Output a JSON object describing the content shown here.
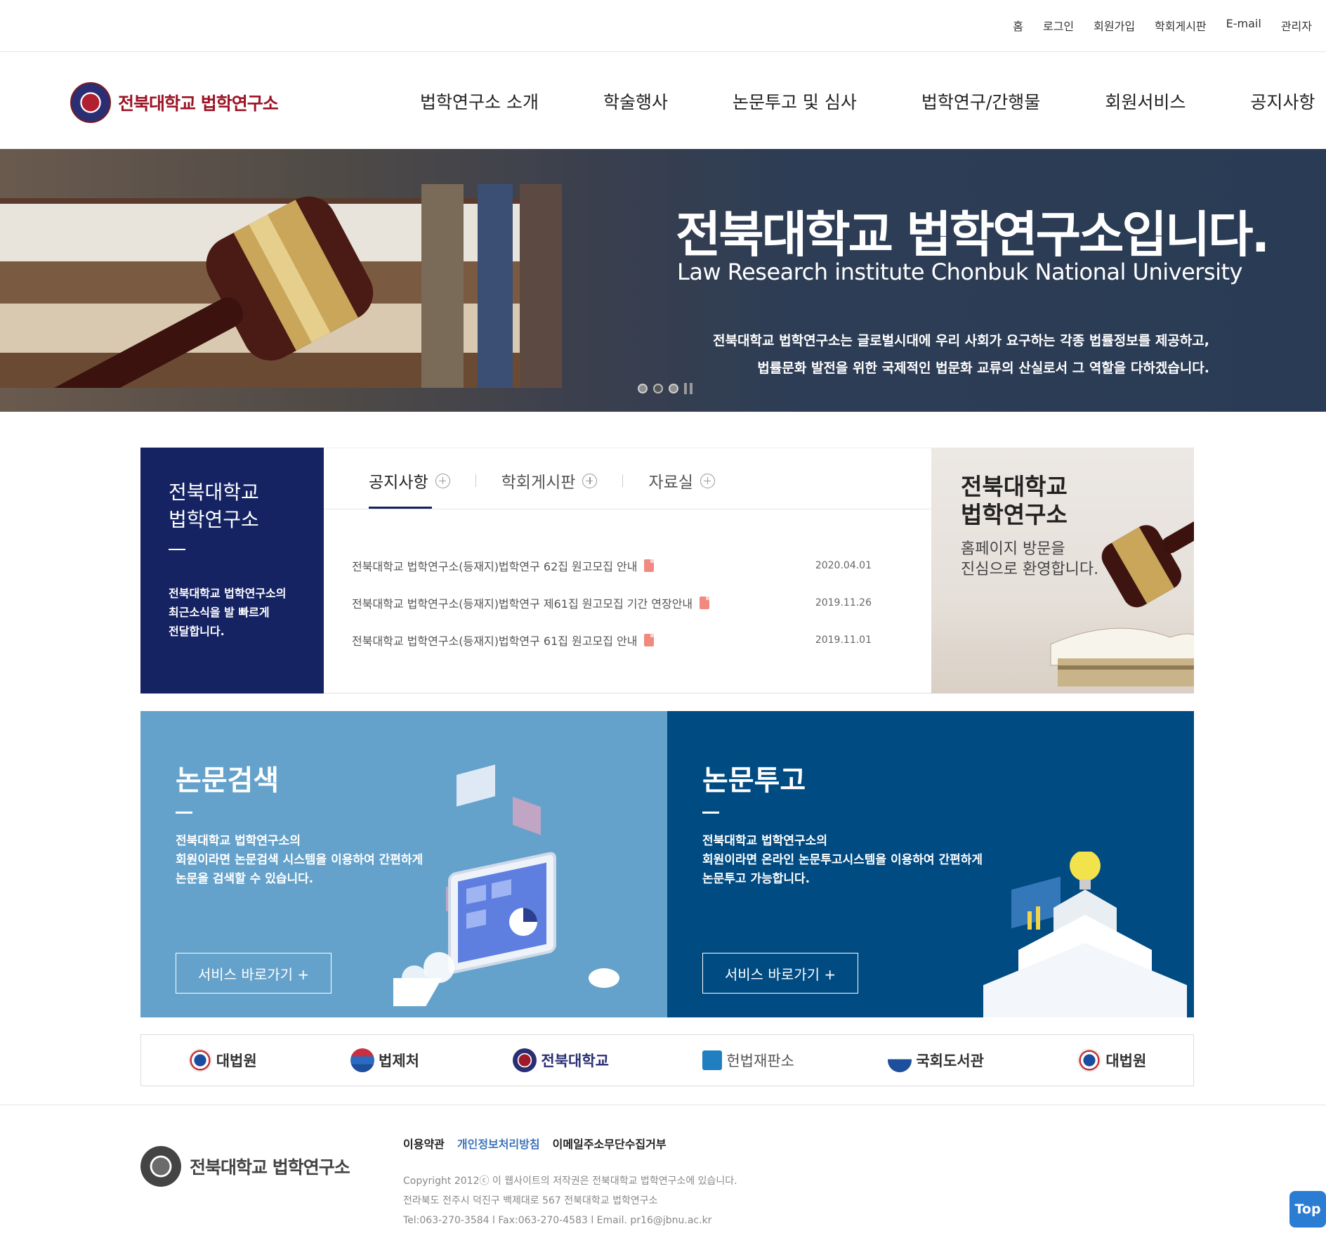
{
  "util_menu": [
    "홈",
    "로그인",
    "회원가입",
    "학회게시판",
    "E-mail",
    "관리자"
  ],
  "logo_text": "전북대학교 법학연구소",
  "gnb": [
    "법학연구소 소개",
    "학술행사",
    "논문투고 및 심사",
    "법학연구/간행물",
    "회원서비스",
    "공지사항"
  ],
  "hero": {
    "title": "전북대학교 법학연구소입니다.",
    "subtitle": "Law Research institute Chonbuk National University",
    "desc1": "전북대학교 법학연구소는 글로벌시대에 우리 사회가 요구하는 각종 법률정보를 제공하고,",
    "desc2": "법률문화 발전을 위한 국제적인 법문화 교류의 산실로서 그 역할을 다하겠습니다."
  },
  "notice_box": {
    "title1": "전북대학교",
    "title2": "법학연구소",
    "desc1": "전북대학교 법학연구소의",
    "desc2": "최근소식을 발 빠르게",
    "desc3": "전달합니다."
  },
  "tabs": [
    "공지사항",
    "학회게시판",
    "자료실"
  ],
  "notices": [
    {
      "title": "전북대학교 법학연구소(등재지)법학연구 62집 원고모집 안내",
      "date": "2020.04.01"
    },
    {
      "title": "전북대학교 법학연구소(등재지)법학연구 제61집 원고모집 기간 연장안내",
      "date": "2019.11.26"
    },
    {
      "title": "전북대학교 법학연구소(등재지)법학연구 61집 원고모집 안내",
      "date": "2019.11.01"
    }
  ],
  "welcome": {
    "title1": "전북대학교",
    "title2": "법학연구소",
    "line1": "홈페이지 방문을",
    "line2": "진심으로 환영합니다."
  },
  "search_service": {
    "title": "논문검색",
    "line1": "전북대학교 법학연구소의",
    "line2": "회원이라면 논문검색 시스템을 이용하여 간편하게",
    "line3": "논문을 검색할 수 있습니다.",
    "button": "서비스 바로가기 +"
  },
  "submit_service": {
    "title": "논문투고",
    "line1": "전북대학교 법학연구소의",
    "line2": "회원이라면 온라인 논문투고시스템을 이용하여 간편하게",
    "line3": "논문투고 가능합니다.",
    "button": "서비스 바로가기 +"
  },
  "partners": [
    "대법원",
    "법제처",
    "전북대학교",
    "헌법재판소",
    "국회도서관",
    "대법원"
  ],
  "footer": {
    "logo_text": "전북대학교 법학연구소",
    "links": [
      "이용약관",
      "개인정보처리방침",
      "이메일주소무단수집거부"
    ],
    "copyright": "Copyright 2012ⓒ 이 웹사이트의 저작권은 전북대학교 법학연구소에 있습니다.",
    "address": "전라북도 전주시 덕진구 백제대로 567 전북대학교 법학연구소",
    "contact": "Tel:063-270-3584  l  Fax:063-270-4583   l  Email. pr16@jbnu.ac.kr"
  },
  "top_button": "Top",
  "colors": {
    "navy": "#162363",
    "light_blue": "#65a2cb",
    "dark_blue": "#004b82",
    "brand_red": "#9c1426"
  }
}
